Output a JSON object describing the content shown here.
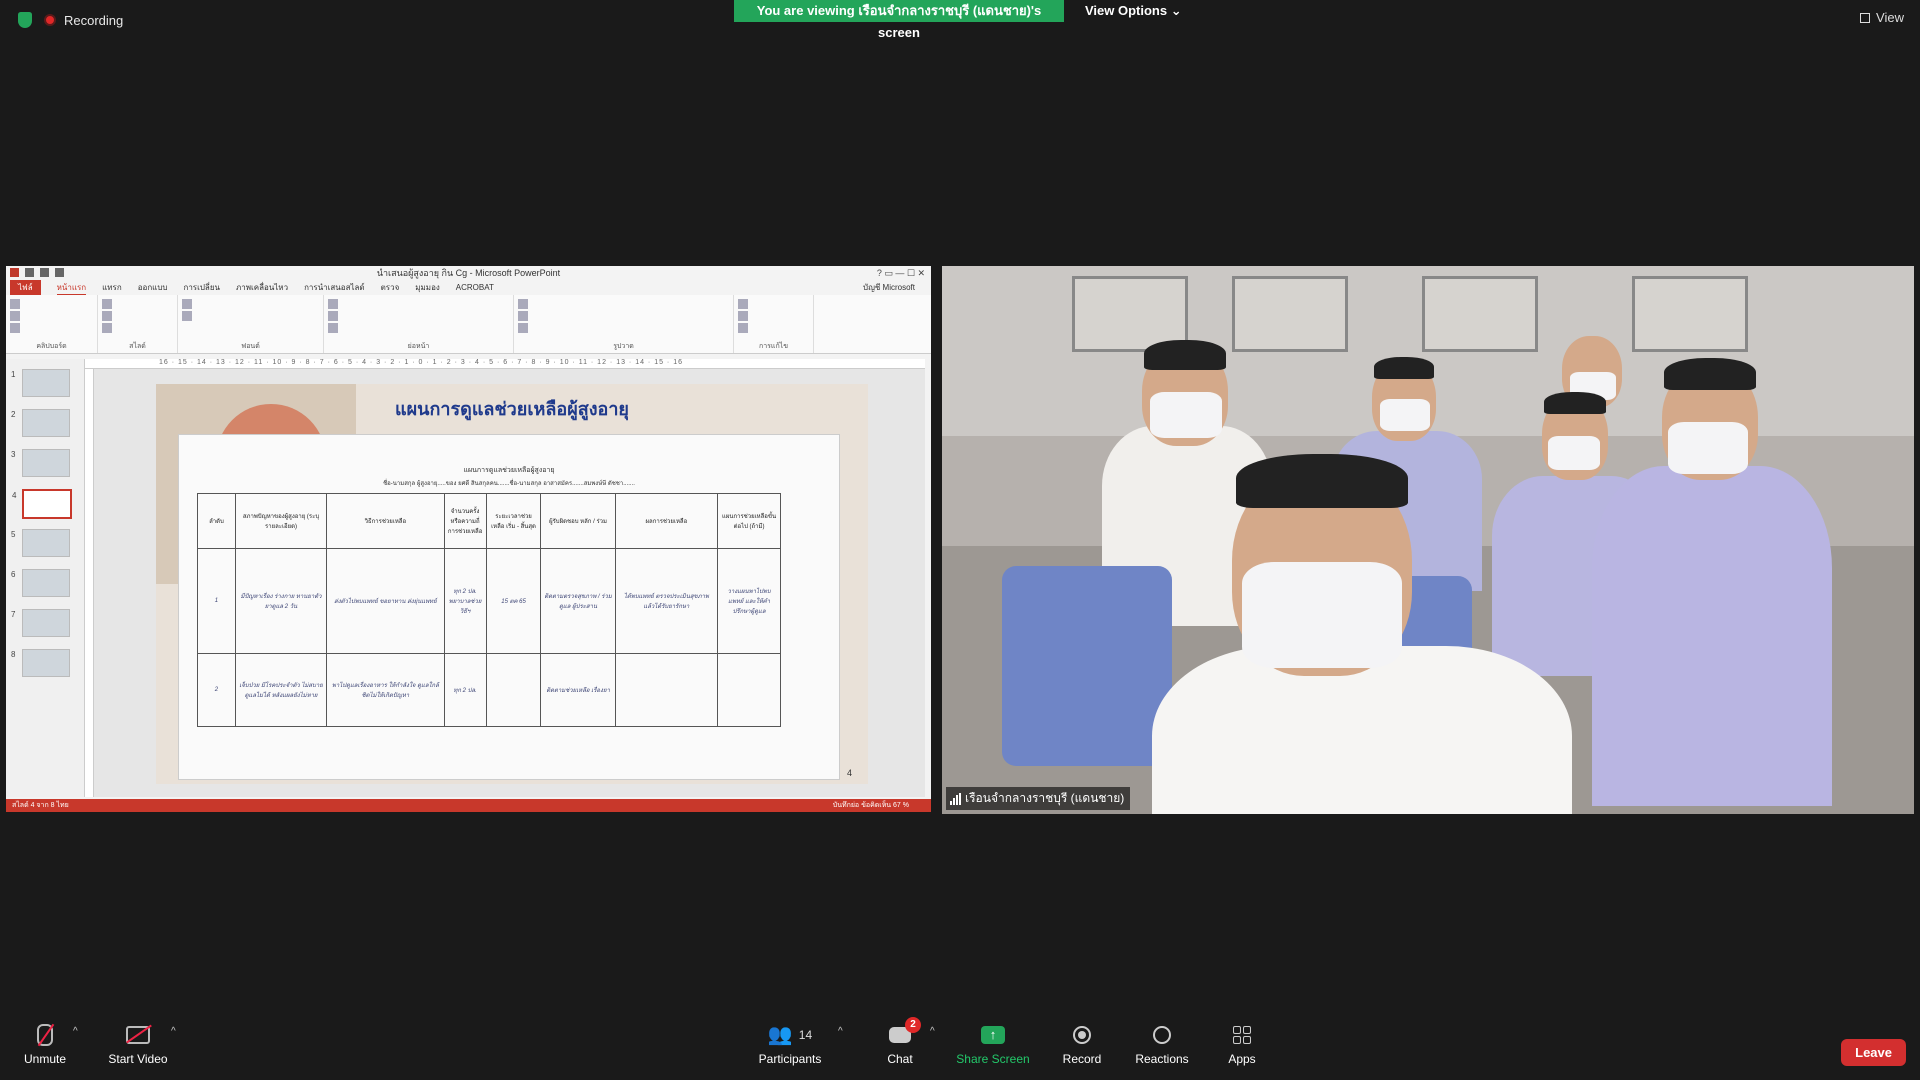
{
  "top": {
    "recording_label": "Recording",
    "viewing_banner": "You are viewing เรือนจำกลางราชบุรี (แดนชาย)'s screen",
    "view_options": "View Options ⌄",
    "view_label": "View"
  },
  "powerpoint": {
    "window_title": "นำเสนอผู้สูงอายุ กิน Cg - Microsoft PowerPoint",
    "tabs": [
      "ไฟล์",
      "หน้าแรก",
      "แทรก",
      "ออกแบบ",
      "การเปลี่ยน",
      "ภาพเคลื่อนไหว",
      "การนำเสนอสไลด์",
      "ตรวจ",
      "มุมมอง",
      "ACROBAT"
    ],
    "account": "บัญชี Microsoft",
    "ribbon_groups": [
      "คลิปบอร์ด",
      "สไลด์",
      "ฟอนต์",
      "ย่อหน้า",
      "รูปวาด",
      "การแก้ไข"
    ],
    "ruler_text": "16 · 15 · 14 · 13 · 12 · 11 · 10 · 9 · 8 · 7 · 6 · 5 · 4 · 3 · 2 · 1 · 0 · 1 · 2 · 3 · 4 · 5 · 6 · 7 · 8 · 9 · 10 · 11 · 12 · 13 · 14 · 15 · 16",
    "thumb_numbers": [
      "1",
      "2",
      "3",
      "4",
      "5",
      "6",
      "7",
      "8"
    ],
    "slide_title": "แผนการดูแลช่วยเหลือผู้สูงอายุ",
    "slide_number": "4",
    "doc_title": "แผนการดูแลช่วยเหลือผู้สูงอายุ",
    "doc_sub": "ชื่อ-นามสกุล ผู้สูงอายุ.....ของ ยศดี สินสกุลคน.......ชื่อ-นามสกุล อาสาสมัคร.......สมพงษ์ษี ดัชชา.......",
    "table_headers": [
      "ลำดับ",
      "สภาพปัญหาของผู้สูงอายุ (ระบุรายละเอียด)",
      "วิธีการช่วยเหลือ",
      "จำนวนครั้งหรือความถี่การช่วยเหลือ",
      "ระยะเวลาช่วยเหลือ เริ่ม - สิ้นสุด",
      "ผู้รับผิดชอบ หลัก / ร่วม",
      "ผลการช่วยเหลือ",
      "แผนการช่วยเหลือขั้นต่อไป (ถ้ามี)"
    ],
    "row1": [
      "1",
      "มีปัญหาเรื่อง ร่างกาย ทานยาตัวยาดูแล 2 วัน",
      "ส่งตัวไปพบแพทย์ ขอยาทาน ส่งยุ่นแพทย์",
      "ทุก 2 ปล. พยาบาลช่วย วิธีฯ",
      "15 ตค 65",
      "ติดตามตรวจสุขภาพ / ร่วมดูแล ผู้ประสาน",
      "ได้พบแพทย์ ตรวจประเมินสุขภาพ แล้วได้รับยารักษา",
      "วางแผนพาไปพบแพทย์ และให้คำปรึกษาผู้ดูแล"
    ],
    "row2": [
      "2",
      "เจ็บป่วย มีโรคประจำตัว ไม่สบาย ดูแลไม่ได้ หลังแผลยังไม่หาย",
      "พาไปดูแลเรื่องอาหาร ให้กำลังใจ ดูแลใกล้ชิดไม่ให้เกิดปัญหา",
      "ทุก 2 ปล.",
      "",
      "ติดตามช่วยเหลือ เรื่องยา",
      "",
      ""
    ],
    "status_left": "สไลด์ 4 จาก 8   ไทย",
    "status_right": "บันทึกย่อ   ข้อคิดเห็น   67 %"
  },
  "video": {
    "participant_name": "เรือนจำกลางราชบุรี (แดนชาย)"
  },
  "toolbar": {
    "unmute": "Unmute",
    "start_video": "Start Video",
    "participants": "Participants",
    "participants_count": "14",
    "chat": "Chat",
    "chat_badge": "2",
    "share_screen": "Share Screen",
    "record": "Record",
    "reactions": "Reactions",
    "apps": "Apps",
    "leave": "Leave"
  },
  "colors": {
    "banner_green": "#23a55a",
    "leave_red": "#d32f2f",
    "powerpoint_red": "#c8382b"
  }
}
